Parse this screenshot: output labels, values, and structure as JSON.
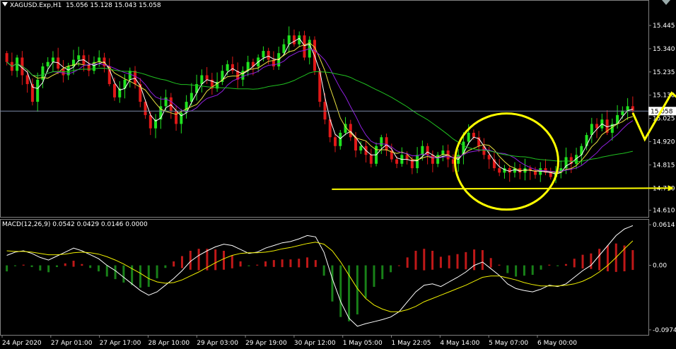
{
  "header": {
    "symbol": "XAGUSD.Exp,H1",
    "ohlc": "15.056 15.128 15.043 15.058",
    "macd_label": "MACD(12,26,9) 0.0542 0.0429 0.0146 0.0000"
  },
  "colors": {
    "background": "#000000",
    "bull": "#1fe21f",
    "bear": "#e01818",
    "ma_fast": "#ffffff",
    "ma_mid": "#e8e040",
    "ma_slow": "#9020e0",
    "ma_long": "#20c020",
    "annotation": "#ffff00",
    "macd_line": "#ffffff",
    "signal_line": "#f0f000",
    "hist_pos": "#c01818",
    "hist_neg": "#188018",
    "grid": "#808080",
    "price_line": "#7b89a8"
  },
  "chart_data": [
    {
      "type": "candlestick",
      "title": "XAGUSD.Exp,H1",
      "ylim": [
        14.58,
        15.56
      ],
      "y_ticks": [
        "15.445",
        "15.340",
        "15.235",
        "15.130",
        "15.025",
        "14.920",
        "14.815",
        "14.710",
        "14.610"
      ],
      "current_price": "15.058",
      "x_labels": [
        "24 Apr 2020",
        "27 Apr 01:00",
        "27 Apr 17:00",
        "28 Apr 10:00",
        "29 Apr 03:00",
        "29 Apr 19:00",
        "30 Apr 12:00",
        "1 May 05:00",
        "1 May 22:05",
        "4 May 14:00",
        "5 May 07:00",
        "6 May 00:00"
      ],
      "closes": [
        15.28,
        15.24,
        15.3,
        15.22,
        15.18,
        15.1,
        15.2,
        15.26,
        15.28,
        15.3,
        15.25,
        15.22,
        15.26,
        15.29,
        15.31,
        15.27,
        15.24,
        15.28,
        15.3,
        15.26,
        15.18,
        15.12,
        15.16,
        15.2,
        15.24,
        15.18,
        15.1,
        15.04,
        14.98,
        15.02,
        15.08,
        15.12,
        15.06,
        15.0,
        15.05,
        15.1,
        15.14,
        15.18,
        15.22,
        15.2,
        15.16,
        15.19,
        15.24,
        15.27,
        15.24,
        15.2,
        15.24,
        15.28,
        15.26,
        15.3,
        15.33,
        15.29,
        15.26,
        15.32,
        15.36,
        15.4,
        15.36,
        15.4,
        15.3,
        15.38,
        15.24,
        15.1,
        15.02,
        14.94,
        14.9,
        14.96,
        15.0,
        14.94,
        14.88,
        14.9,
        14.86,
        14.82,
        14.9,
        14.94,
        14.88,
        14.84,
        14.82,
        14.86,
        14.84,
        14.8,
        14.86,
        14.9,
        14.86,
        14.82,
        14.86,
        14.88,
        14.84,
        14.82,
        14.86,
        14.92,
        14.96,
        14.94,
        14.9,
        14.86,
        14.84,
        14.8,
        14.78,
        14.8,
        14.78,
        14.8,
        14.78,
        14.8,
        14.79,
        14.77,
        14.8,
        14.78,
        14.76,
        14.78,
        14.8,
        14.85,
        14.82,
        14.86,
        14.9,
        14.95,
        15.0,
        14.98,
        15.02,
        14.96,
        15.0,
        15.04,
        15.06,
        15.08,
        15.06
      ]
    },
    {
      "type": "macd",
      "title": "MACD(12,26,9)",
      "params": "(12,26,9)",
      "ylim": [
        -0.105,
        0.07
      ],
      "y_ticks": [
        "0.0614",
        "0.00",
        "-0.0974"
      ],
      "macd_values": [
        0.015,
        0.02,
        0.022,
        0.018,
        0.012,
        0.008,
        0.014,
        0.02,
        0.026,
        0.022,
        0.016,
        0.01,
        0.0,
        -0.008,
        -0.018,
        -0.028,
        -0.038,
        -0.045,
        -0.04,
        -0.03,
        -0.02,
        -0.008,
        0.006,
        0.015,
        0.022,
        0.028,
        0.032,
        0.03,
        0.024,
        0.018,
        0.02,
        0.026,
        0.03,
        0.034,
        0.036,
        0.04,
        0.045,
        0.043,
        0.02,
        -0.02,
        -0.055,
        -0.08,
        -0.092,
        -0.088,
        -0.085,
        -0.082,
        -0.078,
        -0.07,
        -0.055,
        -0.04,
        -0.03,
        -0.028,
        -0.032,
        -0.025,
        -0.018,
        -0.01,
        0.0,
        0.005,
        -0.005,
        -0.015,
        -0.028,
        -0.035,
        -0.038,
        -0.04,
        -0.036,
        -0.03,
        -0.032,
        -0.028,
        -0.018,
        -0.008,
        0.0,
        0.015,
        0.03,
        0.045,
        0.055,
        0.06
      ],
      "signal_values": [
        0.022,
        0.021,
        0.021,
        0.02,
        0.018,
        0.016,
        0.016,
        0.017,
        0.019,
        0.02,
        0.019,
        0.017,
        0.013,
        0.008,
        0.002,
        -0.005,
        -0.012,
        -0.02,
        -0.025,
        -0.027,
        -0.026,
        -0.022,
        -0.016,
        -0.01,
        -0.003,
        0.004,
        0.01,
        0.015,
        0.018,
        0.019,
        0.019,
        0.02,
        0.022,
        0.025,
        0.027,
        0.03,
        0.033,
        0.035,
        0.032,
        0.022,
        0.005,
        -0.015,
        -0.035,
        -0.05,
        -0.06,
        -0.066,
        -0.07,
        -0.07,
        -0.067,
        -0.062,
        -0.055,
        -0.05,
        -0.045,
        -0.04,
        -0.035,
        -0.03,
        -0.024,
        -0.018,
        -0.016,
        -0.016,
        -0.019,
        -0.022,
        -0.026,
        -0.029,
        -0.031,
        -0.031,
        -0.031,
        -0.03,
        -0.028,
        -0.024,
        -0.018,
        -0.01,
        0.0,
        0.012,
        0.025,
        0.037
      ]
    }
  ]
}
